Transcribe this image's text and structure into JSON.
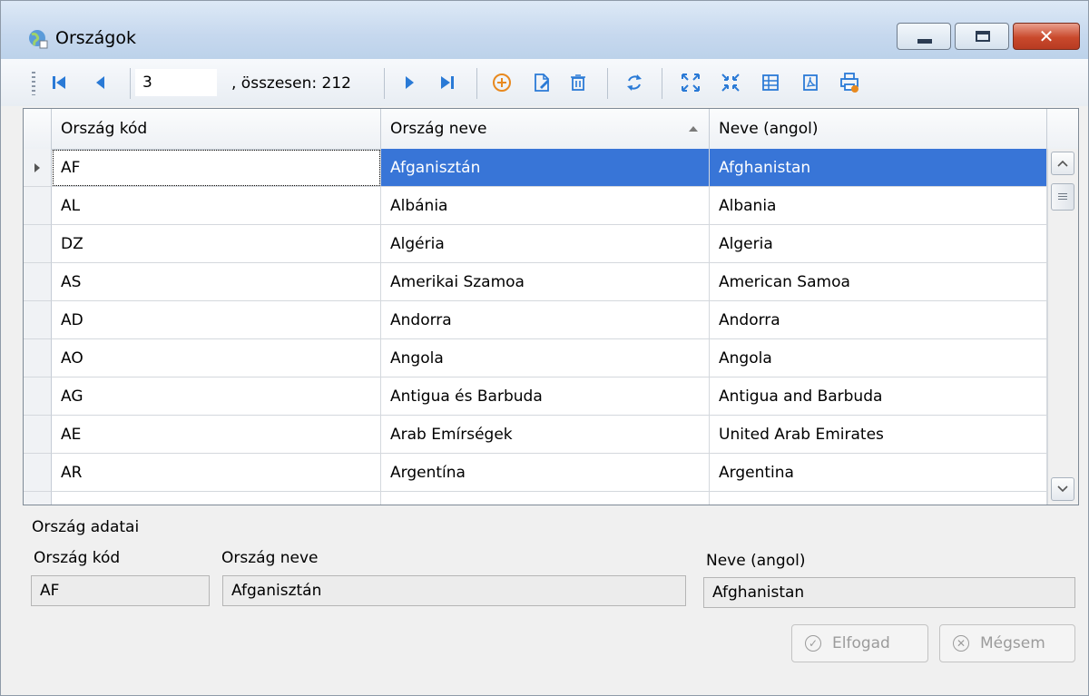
{
  "window": {
    "title": "Országok"
  },
  "toolbar": {
    "position_value": "3",
    "total_label": ", összesen: 212"
  },
  "grid": {
    "columns": [
      "Ország kód",
      "Ország neve",
      "Neve (angol)"
    ],
    "sorted_column": "Ország neve",
    "rows": [
      [
        "AF",
        "Afganisztán",
        "Afghanistan"
      ],
      [
        "AL",
        "Albánia",
        "Albania"
      ],
      [
        "DZ",
        "Algéria",
        "Algeria"
      ],
      [
        "AS",
        "Amerikai Szamoa",
        "American Samoa"
      ],
      [
        "AD",
        "Andorra",
        "Andorra"
      ],
      [
        "AO",
        "Angola",
        "Angola"
      ],
      [
        "AG",
        "Antigua és Barbuda",
        "Antigua and Barbuda"
      ],
      [
        "AE",
        "Arab Emírségek",
        "United Arab Emirates"
      ],
      [
        "AR",
        "Argentína",
        "Argentina"
      ]
    ],
    "selected_row": 0
  },
  "details": {
    "title": "Ország adatai",
    "code_label": "Ország kód",
    "code_value": "AF",
    "name_label": "Ország neve",
    "name_value": "Afganisztán",
    "english_label": "Neve (angol)",
    "english_value": "Afghanistan"
  },
  "actions": {
    "accept_label": "Elfogad",
    "cancel_label": "Mégsem"
  },
  "colors": {
    "selection": "#3875d7",
    "icon_blue": "#2a7ad6",
    "icon_orange": "#e8891f"
  }
}
